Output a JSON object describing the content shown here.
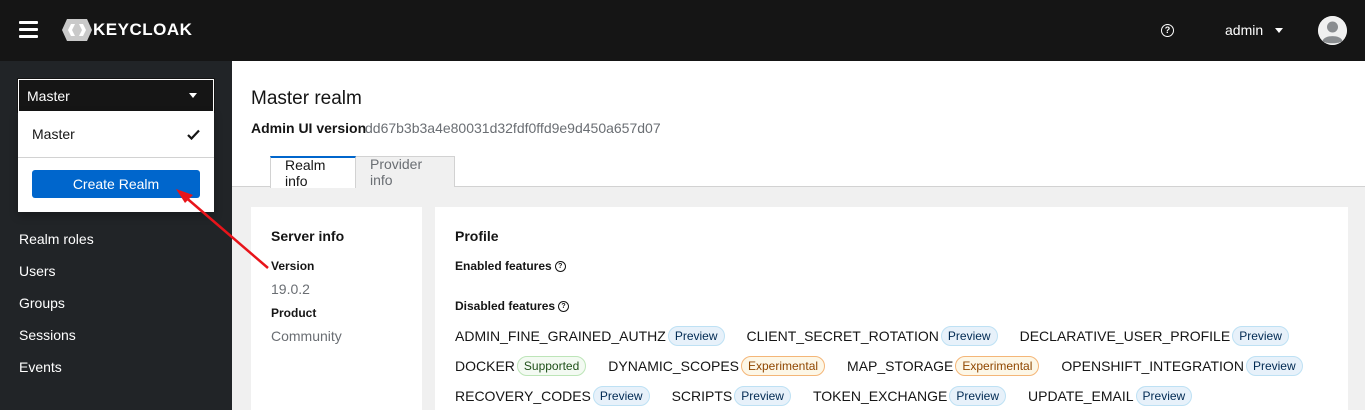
{
  "masthead": {
    "logo_text": "KEYCLOAK",
    "help_icon": "?",
    "username": "admin"
  },
  "sidebar": {
    "realm_selected": "Master",
    "nav_items": [
      "Realm roles",
      "Users",
      "Groups",
      "Sessions",
      "Events"
    ]
  },
  "realm_dropdown": {
    "item_label": "Master",
    "create_button_label": "Create Realm"
  },
  "page": {
    "title": "Master realm",
    "admin_ui_version_label": "Admin UI version",
    "admin_ui_version_value": "dd67b3b3a4e80031d32fdf0ffd9e9d450a657d07",
    "tabs": [
      {
        "label": "Realm info",
        "active": true
      },
      {
        "label": "Provider info",
        "active": false
      }
    ]
  },
  "server_info": {
    "title": "Server info",
    "version_label": "Version",
    "version_value": "19.0.2",
    "product_label": "Product",
    "product_value": "Community"
  },
  "profile": {
    "title": "Profile",
    "enabled_label": "Enabled features",
    "disabled_label": "Disabled features",
    "disabled_features": [
      [
        {
          "name": "ADMIN_FINE_GRAINED_AUTHZ",
          "status": "Preview",
          "type": "preview"
        },
        {
          "name": "CLIENT_SECRET_ROTATION",
          "status": "Preview",
          "type": "preview"
        },
        {
          "name": "DECLARATIVE_USER_PROFILE",
          "status": "Preview",
          "type": "preview"
        }
      ],
      [
        {
          "name": "DOCKER",
          "status": "Supported",
          "type": "supported"
        },
        {
          "name": "DYNAMIC_SCOPES",
          "status": "Experimental",
          "type": "experimental"
        },
        {
          "name": "MAP_STORAGE",
          "status": "Experimental",
          "type": "experimental"
        },
        {
          "name": "OPENSHIFT_INTEGRATION",
          "status": "Preview",
          "type": "preview"
        }
      ],
      [
        {
          "name": "RECOVERY_CODES",
          "status": "Preview",
          "type": "preview"
        },
        {
          "name": "SCRIPTS",
          "status": "Preview",
          "type": "preview"
        },
        {
          "name": "TOKEN_EXCHANGE",
          "status": "Preview",
          "type": "preview"
        },
        {
          "name": "UPDATE_EMAIL",
          "status": "Preview",
          "type": "preview"
        }
      ]
    ]
  },
  "colors": {
    "masthead_bg": "#151515",
    "sidebar_bg": "#212427",
    "primary": "#0066cc",
    "annotation_arrow": "#e8141a"
  }
}
